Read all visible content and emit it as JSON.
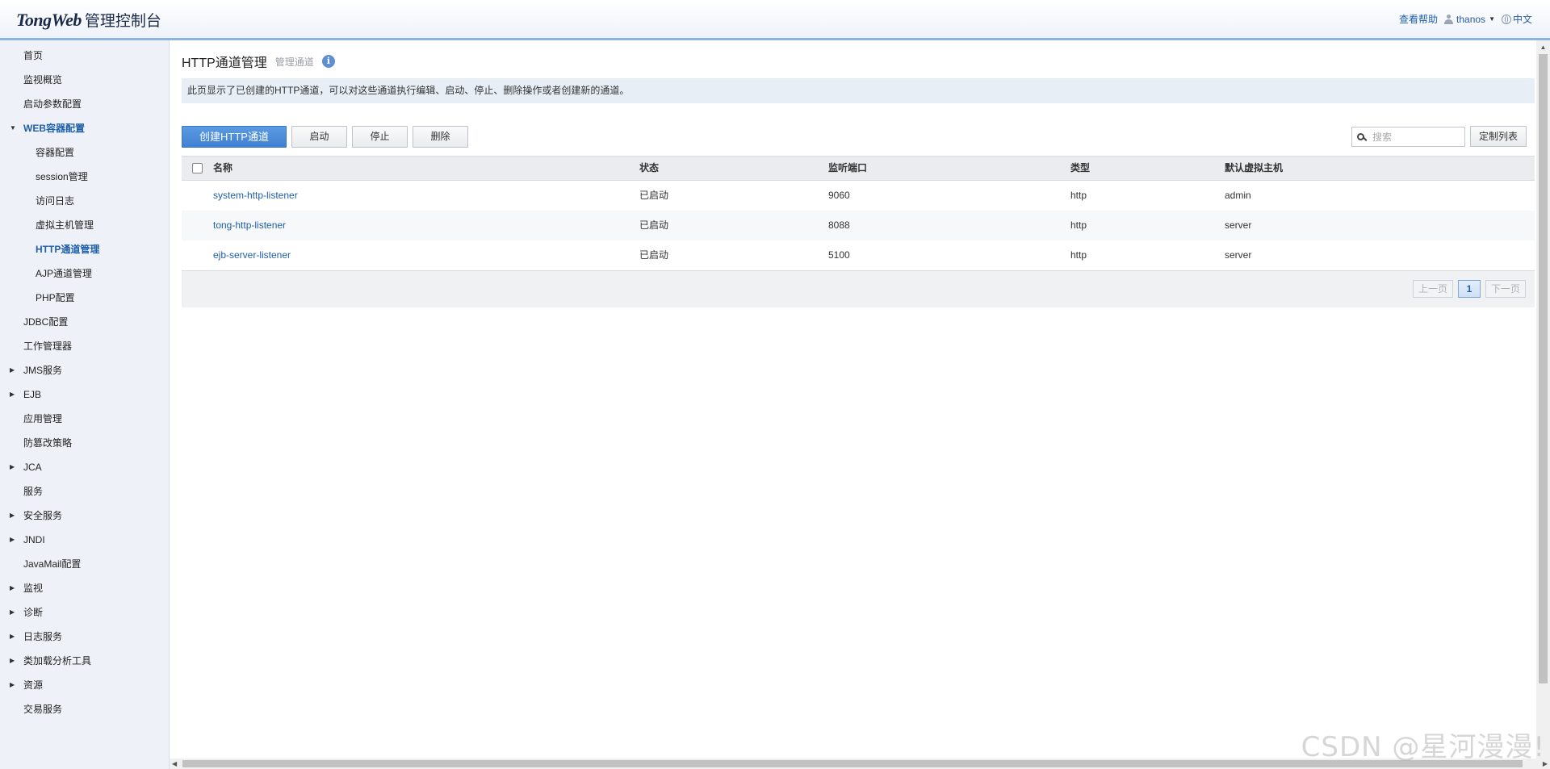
{
  "header": {
    "logo_text": "TongWeb",
    "logo_sub": "管理控制台",
    "help": "查看帮助",
    "user": "thanos",
    "language": "中文"
  },
  "sidebar": {
    "items": [
      {
        "label": "首页"
      },
      {
        "label": "监视概览"
      },
      {
        "label": "启动参数配置"
      },
      {
        "label": "WEB容器配置",
        "expanded": true
      },
      {
        "label": "容器配置"
      },
      {
        "label": "session管理"
      },
      {
        "label": "访问日志"
      },
      {
        "label": "虚拟主机管理"
      },
      {
        "label": "HTTP通道管理",
        "selected": true
      },
      {
        "label": "AJP通道管理"
      },
      {
        "label": "PHP配置"
      },
      {
        "label": "JDBC配置"
      },
      {
        "label": "工作管理器"
      },
      {
        "label": "JMS服务"
      },
      {
        "label": "EJB"
      },
      {
        "label": "应用管理"
      },
      {
        "label": "防篡改策略"
      },
      {
        "label": "JCA"
      },
      {
        "label": "服务"
      },
      {
        "label": "安全服务"
      },
      {
        "label": "JNDI"
      },
      {
        "label": "JavaMail配置"
      },
      {
        "label": "监视"
      },
      {
        "label": "诊断"
      },
      {
        "label": "日志服务"
      },
      {
        "label": "类加载分析工具"
      },
      {
        "label": "资源"
      },
      {
        "label": "交易服务"
      }
    ]
  },
  "main": {
    "title": "HTTP通道管理",
    "subtitle": "管理通道",
    "info_icon": "i",
    "description": "此页显示了已创建的HTTP通道，可以对这些通道执行编辑、启动、停止、删除操作或者创建新的通道。",
    "toolbar": {
      "create": "创建HTTP通道",
      "start": "启动",
      "stop": "停止",
      "delete": "删除",
      "search_placeholder": "搜索",
      "customize": "定制列表"
    },
    "table": {
      "columns": [
        "名称",
        "状态",
        "监听端口",
        "类型",
        "默认虚拟主机"
      ],
      "rows": [
        {
          "name": "system-http-listener",
          "status": "已启动",
          "port": "9060",
          "type": "http",
          "host": "admin"
        },
        {
          "name": "tong-http-listener",
          "status": "已启动",
          "port": "8088",
          "type": "http",
          "host": "server"
        },
        {
          "name": "ejb-server-listener",
          "status": "已启动",
          "port": "5100",
          "type": "http",
          "host": "server"
        }
      ]
    },
    "pager": {
      "prev": "上一页",
      "current": "1",
      "next": "下一页"
    }
  },
  "watermark": "CSDN @星河漫漫!"
}
